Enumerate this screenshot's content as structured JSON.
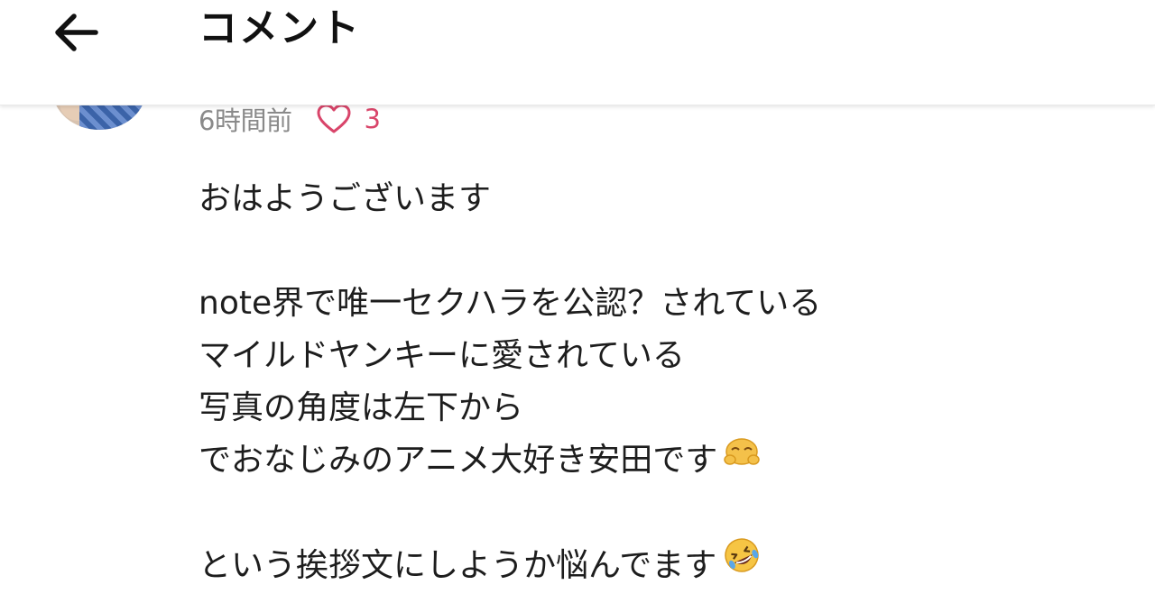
{
  "header": {
    "title": "コメント",
    "back_icon": "arrow-left-icon"
  },
  "comment": {
    "avatar_icon": "user-avatar",
    "timestamp": "6時間前",
    "likes": {
      "icon": "heart-outline-icon",
      "count": "3",
      "color": "#d9456a"
    },
    "lines": [
      "おはようございます",
      "",
      "note界で唯一セクハラを公認？されている",
      "マイルドヤンキーに愛されている",
      "写真の角度は左下から",
      "でおなじみのアニメ大好き安田です",
      "",
      "という挨拶文にしようか悩んでます"
    ],
    "emojis": {
      "line6": "bowing-face-emoji",
      "line8": "rolling-laughing-emoji"
    }
  }
}
